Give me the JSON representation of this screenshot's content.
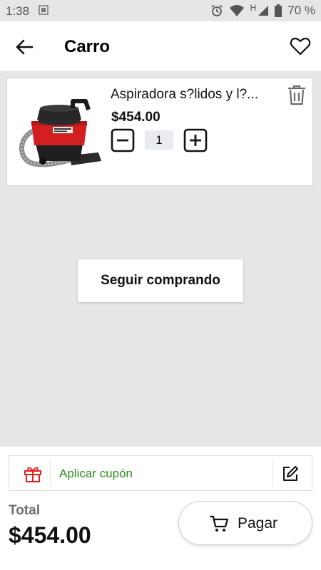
{
  "status_bar": {
    "time": "1:38",
    "network": "H",
    "battery": "70 %"
  },
  "appbar": {
    "title": "Carro",
    "back_icon": "arrow-left-icon",
    "favorite_icon": "heart-icon"
  },
  "cart": {
    "items": [
      {
        "name": "Aspiradora s?lidos y l?...",
        "price": "$454.00",
        "quantity": "1"
      }
    ]
  },
  "continue_label": "Seguir comprando",
  "coupon": {
    "label": "Aplicar cupón",
    "label_color": "#2e8b1e",
    "gift_color": "#e0211b"
  },
  "total": {
    "label": "Total",
    "value": "$454.00"
  },
  "checkout": {
    "label": "Pagar"
  },
  "colors": {
    "background_gray": "#e6e6e6",
    "qty_bg": "#e8ebf0"
  }
}
